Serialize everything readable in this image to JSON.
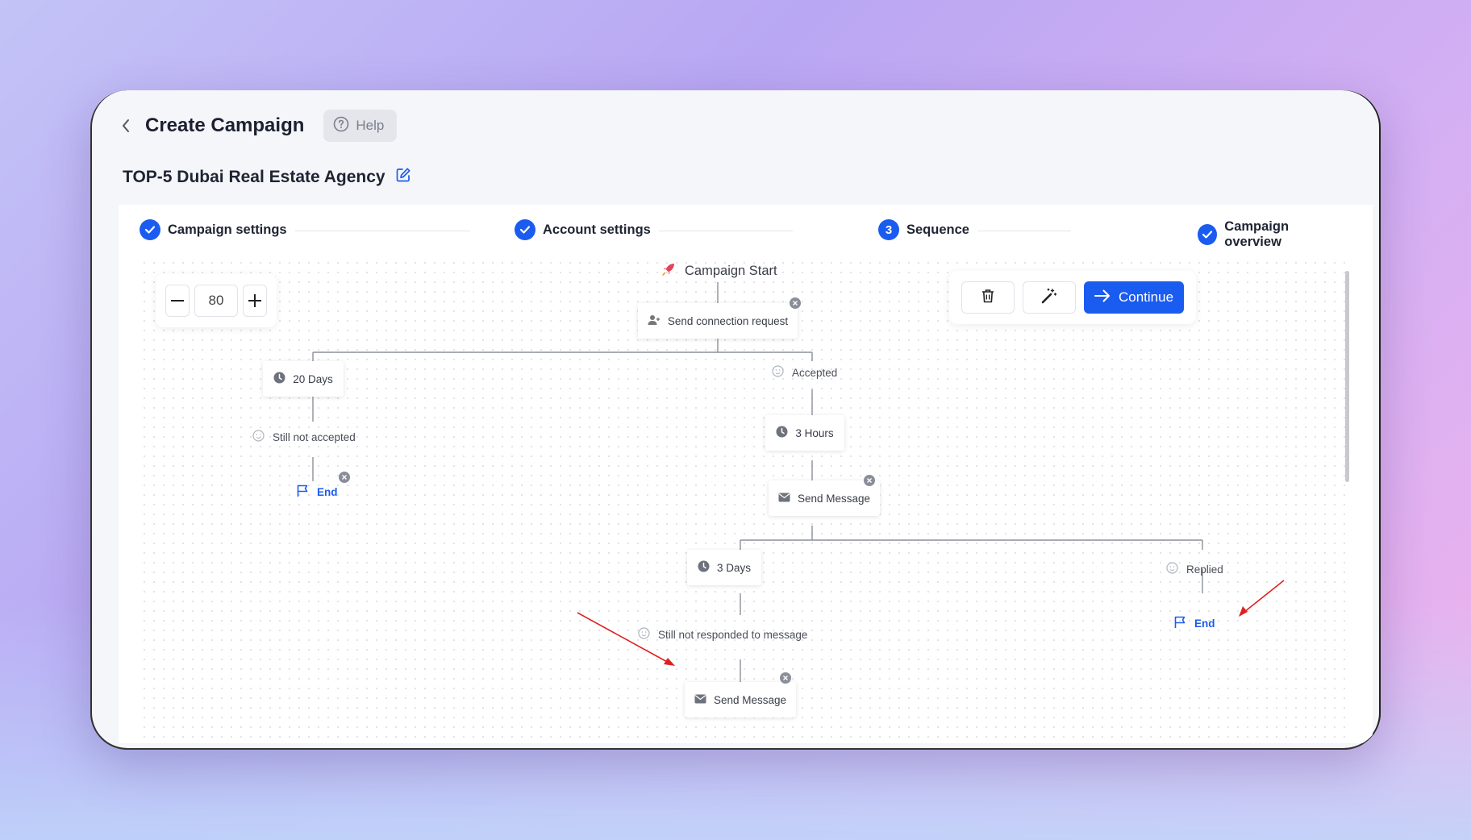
{
  "header": {
    "title": "Create Campaign",
    "help_label": "Help"
  },
  "campaign": {
    "name": "TOP-5 Dubai Real Estate Agency"
  },
  "stepper": {
    "steps": [
      {
        "label": "Campaign settings",
        "state": "done"
      },
      {
        "label": "Account settings",
        "state": "done"
      },
      {
        "label": "Sequence",
        "state": "active",
        "number": "3"
      },
      {
        "label": "Campaign overview",
        "state": "done"
      }
    ]
  },
  "zoom": {
    "value": "80"
  },
  "actions": {
    "continue_label": "Continue"
  },
  "flow": {
    "start": "Campaign Start",
    "connection_request": "Send connection request",
    "wait_20_days": "20 Days",
    "still_not_accepted": "Still not accepted",
    "end_1": "End",
    "accepted": "Accepted",
    "wait_3_hours": "3 Hours",
    "send_message_1": "Send Message",
    "wait_3_days": "3 Days",
    "still_not_responded": "Still not responded to message",
    "send_message_2": "Send Message",
    "replied": "Replied",
    "end_2": "End"
  },
  "colors": {
    "accent": "#1a5cf0",
    "annotation_arrow": "#e02020"
  }
}
